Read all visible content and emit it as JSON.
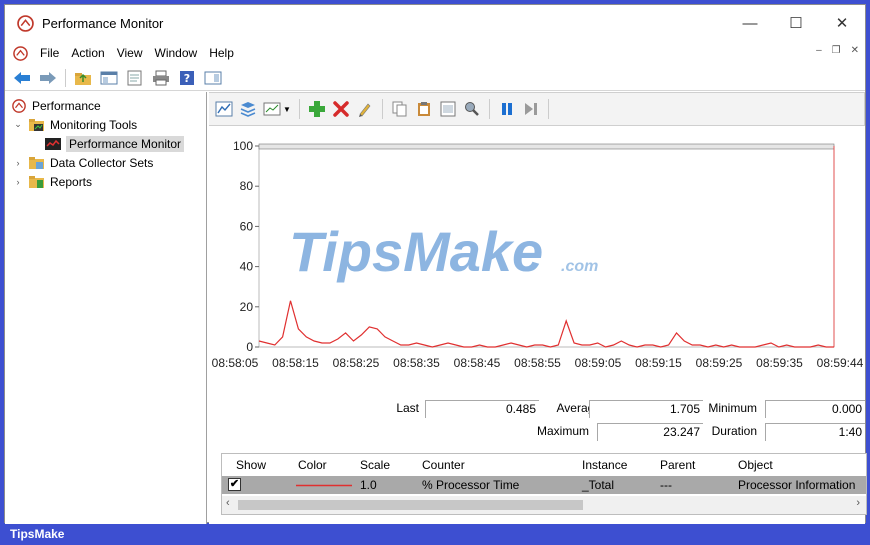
{
  "window": {
    "title": "Performance Monitor"
  },
  "menu": [
    "File",
    "Action",
    "View",
    "Window",
    "Help"
  ],
  "tree": {
    "root": "Performance",
    "items": [
      {
        "label": "Monitoring Tools"
      },
      {
        "label": "Performance Monitor"
      },
      {
        "label": "Data Collector Sets"
      },
      {
        "label": "Reports"
      }
    ]
  },
  "chart_data": {
    "type": "line",
    "ylim": [
      0,
      100
    ],
    "yticks": [
      "100",
      "80",
      "60",
      "40",
      "20",
      "0"
    ],
    "xticks": [
      "08:58:05",
      "08:58:15",
      "08:58:25",
      "08:58:35",
      "08:58:45",
      "08:58:55",
      "08:59:05",
      "08:59:15",
      "08:59:25",
      "08:59:35",
      "08:59:44"
    ],
    "series": [
      {
        "name": "% Processor Time",
        "color": "#e03030",
        "values": [
          3,
          2,
          1,
          5,
          23,
          9,
          5,
          3,
          2,
          2,
          4,
          7,
          3,
          6,
          10,
          9,
          5,
          3,
          1,
          1,
          2,
          1,
          0,
          1,
          2,
          1,
          0,
          0,
          1,
          0,
          0,
          1,
          2,
          1,
          0,
          1,
          1,
          0,
          1,
          13,
          2,
          1,
          1,
          2,
          0,
          1,
          3,
          1,
          0,
          1,
          1,
          0,
          1,
          7,
          3,
          1,
          1,
          0,
          1,
          0,
          1,
          0,
          0,
          0,
          1,
          2,
          0,
          1,
          0,
          0,
          0,
          1,
          0,
          0
        ]
      }
    ]
  },
  "watermark": {
    "main": "TipsMake",
    "suffix": ".com"
  },
  "stats": {
    "last_label": "Last",
    "last": "0.485",
    "average_label": "Average",
    "average": "1.705",
    "minimum_label": "Minimum",
    "minimum": "0.000",
    "maximum_label": "Maximum",
    "maximum": "23.247",
    "duration_label": "Duration",
    "duration": "1:40"
  },
  "legend": {
    "headers": {
      "show": "Show",
      "color": "Color",
      "scale": "Scale",
      "counter": "Counter",
      "instance": "Instance",
      "parent": "Parent",
      "object": "Object"
    },
    "row": {
      "checked": "✔",
      "scale": "1.0",
      "counter": "% Processor Time",
      "instance": "_Total",
      "parent": "---",
      "object": "Processor Information",
      "color": "#e03030"
    }
  },
  "footer": {
    "brand": "TipsMake"
  }
}
